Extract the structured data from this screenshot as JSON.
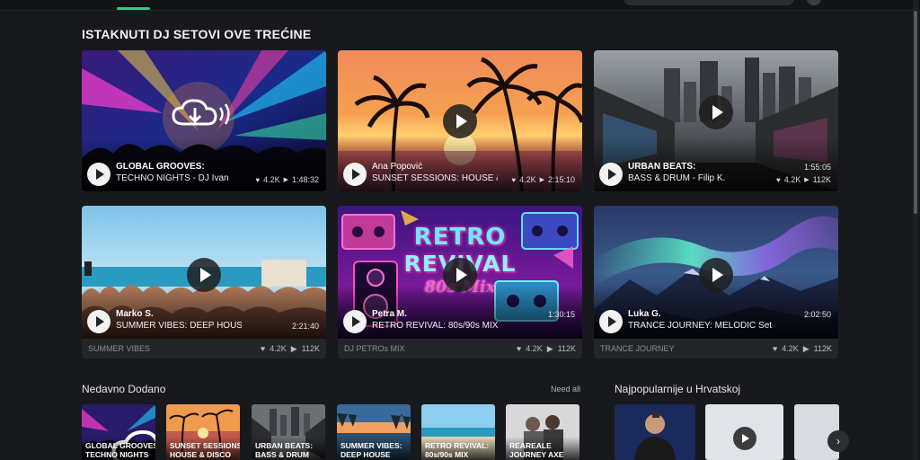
{
  "featured": {
    "title": "ISTAKNUTI DJ SETOVI OVE TREĆINE",
    "cards": [
      {
        "artist": "GLOBAL GROOVES:",
        "subtitle": "TECHNO NIGHTS - DJ Ivan",
        "likes": "4.2K",
        "duration": "1:48:32"
      },
      {
        "artist": "Ana Popović",
        "subtitle": "SUNSET SESSIONS: HOUSE &",
        "likes": "4.2K",
        "duration": "2:15:10"
      },
      {
        "artist": "URBAN BEATS:",
        "subtitle": "BASS & DRUM - Filip K.",
        "duration": "1:55:05",
        "likes": "4.2K",
        "plays": "112K"
      },
      {
        "artist": "Marko S.",
        "subtitle": "SUMMER VIBES: DEEP HOUSE",
        "duration": "2:21:40",
        "footer": "SUMMER VIBES",
        "likes": "4.2K",
        "plays": "112K"
      },
      {
        "artist": "Petra M.",
        "subtitle": "RETRO REVIVAL: 80s/90s MIX",
        "duration": "1:30:15",
        "footer": "DJ PETROs MIX",
        "likes": "4.2K",
        "plays": "112K",
        "art_text_1": "RETRO",
        "art_text_2": "REVIVAL",
        "art_text_3": "80s Mix"
      },
      {
        "artist": "Luka G.",
        "subtitle": "TRANCE JOURNEY: MELODIC Set",
        "duration": "2:02:50",
        "footer": "TRANCE JOURNEY",
        "likes": "4.2K",
        "plays": "112K"
      }
    ]
  },
  "recent": {
    "title": "Nedavno Dodano",
    "see_all": "Need all",
    "items": [
      {
        "label": "GLOBAL GROOVES:\nTECHNO NIGHTS"
      },
      {
        "label": "SUNSET SESSIONS:\nHOUSE & DISCO"
      },
      {
        "label": "URBAN BEATS:\nBASS & DRUM"
      },
      {
        "label": "SUMMER VIBES:\nDEEP HOUSE"
      },
      {
        "label": "RETRO REVIVAL:\n80s/90s MIX"
      },
      {
        "label": "REAREALE\nJOURNEY AXE"
      }
    ]
  },
  "popular": {
    "title": "Najpopularnije u Hrvatskoj",
    "next_icon": "›"
  },
  "colors": {
    "accent": "#2ecc8a",
    "background": "#17191c",
    "card": "#232629"
  }
}
